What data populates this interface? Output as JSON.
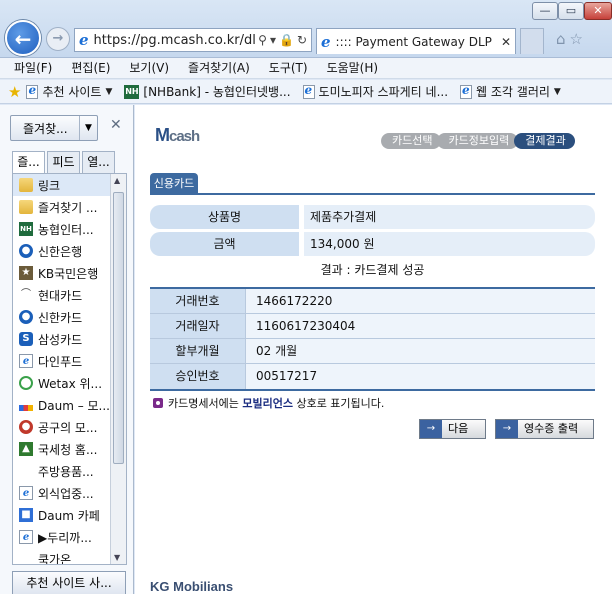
{
  "browser": {
    "url": "https://pg.mcash.co.kr/dlp",
    "tab_title": ":::: Payment Gateway DLP ::::",
    "menu": [
      "파일(F)",
      "편집(E)",
      "보기(V)",
      "즐겨찾기(A)",
      "도구(T)",
      "도움말(H)"
    ],
    "favbar": [
      {
        "label": "추천 사이트",
        "icon": "page-icon",
        "dropdown": true
      },
      {
        "label": "[NHBank] - 농협인터넷뱅...",
        "icon": "nh-icon",
        "dropdown": false
      },
      {
        "label": "도미노피자 스파게티  네...",
        "icon": "page-icon",
        "dropdown": false
      },
      {
        "label": "웹 조각 갤러리",
        "icon": "page-icon",
        "dropdown": true
      }
    ]
  },
  "sidepane": {
    "dropdown_label": "즐겨찾...",
    "tabs": [
      "즐...",
      "피드",
      "열..."
    ],
    "items": [
      {
        "label": "링크",
        "icon": "folder"
      },
      {
        "label": "즐겨찾기 ...",
        "icon": "folder"
      },
      {
        "label": "농협인터...",
        "icon": "nh"
      },
      {
        "label": "신한은행",
        "icon": "shinhan"
      },
      {
        "label": "KB국민은행",
        "icon": "kb"
      },
      {
        "label": "현대카드",
        "icon": "hyundai"
      },
      {
        "label": "신한카드",
        "icon": "shinhan"
      },
      {
        "label": "삼성카드",
        "icon": "samsung"
      },
      {
        "label": "다인푸드",
        "icon": "dain"
      },
      {
        "label": "Wetax 위...",
        "icon": "wetax"
      },
      {
        "label": "Daum – 모...",
        "icon": "daum"
      },
      {
        "label": "공구의 모...",
        "icon": "gongu"
      },
      {
        "label": "국세청 홈...",
        "icon": "tax"
      },
      {
        "label": "주방용품...",
        "icon": "jubang"
      },
      {
        "label": "외식업중...",
        "icon": "dain"
      },
      {
        "label": "Daum 카페",
        "icon": "cafe"
      },
      {
        "label": "▶두리까...",
        "icon": "dain"
      },
      {
        "label": "쿡가온",
        "icon": "kuk"
      }
    ],
    "bottom_button": "추천 사이트 사..."
  },
  "payment": {
    "logo_m": "M",
    "logo_cash": "cash",
    "steps": [
      "카드선택",
      "카드정보입력",
      "결제결과"
    ],
    "active_step": 2,
    "tab_label": "신용카드",
    "product_key": "상품명",
    "product_value": "제품추가결제",
    "amount_key": "금액",
    "amount_value": "134,000 원",
    "result_text": "결과 : 카드결제 성공",
    "details": [
      {
        "key": "거래번호",
        "value": "1466172220"
      },
      {
        "key": "거래일자",
        "value": "1160617230404"
      },
      {
        "key": "할부개월",
        "value": "02 개월"
      },
      {
        "key": "승인번호",
        "value": "00517217"
      }
    ],
    "notice_pre": "카드명세서에는",
    "notice_brand": "모빌리언스",
    "notice_post": "상호로 표기됩니다.",
    "btn_next": "다음",
    "btn_receipt": "영수증 출력",
    "footer_logo": "KG Mobilians"
  },
  "colors": {
    "accent": "#3d6aa0",
    "step_active": "#2b4f7e",
    "step_inactive": "#a8abaf"
  }
}
